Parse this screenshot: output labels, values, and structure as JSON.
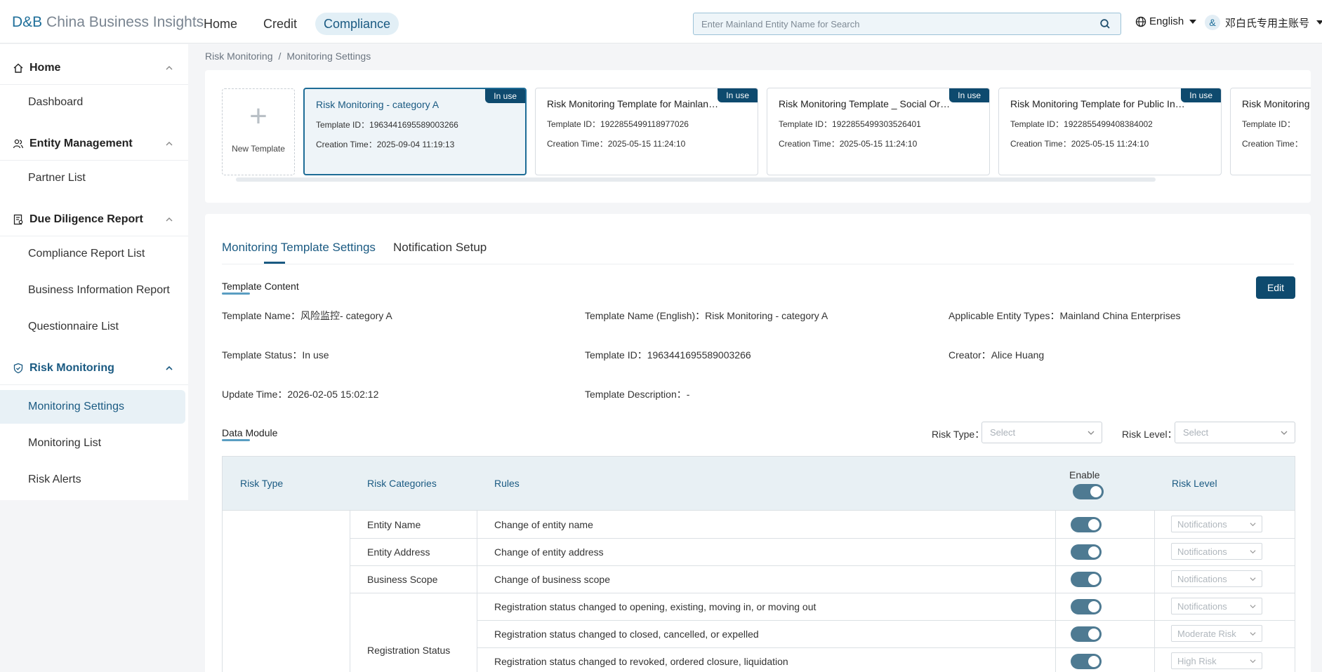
{
  "header": {
    "logo_db": "D&B",
    "logo_text": "China Business Insights",
    "nav": [
      "Home",
      "Credit",
      "Compliance"
    ],
    "search_placeholder": "Enter Mainland Entity Name for Search",
    "language": "English",
    "account": "邓白氏专用主账号"
  },
  "sidebar": {
    "sections": [
      {
        "label": "Home",
        "icon": "home-icon",
        "items": [
          "Dashboard"
        ]
      },
      {
        "label": "Entity Management",
        "icon": "users-icon",
        "items": [
          "Partner List"
        ]
      },
      {
        "label": "Due Diligence Report",
        "icon": "report-icon",
        "items": [
          "Compliance Report List",
          "Business Information Report",
          "Questionnaire List"
        ]
      },
      {
        "label": "Risk Monitoring",
        "icon": "shield-icon",
        "items": [
          "Monitoring Settings",
          "Monitoring List",
          "Risk Alerts"
        ]
      }
    ]
  },
  "breadcrumb": [
    "Risk Monitoring",
    "/",
    "Monitoring Settings"
  ],
  "templates": {
    "new_label": "New Template",
    "id_label": "Template ID：",
    "time_label": "Creation Time：",
    "cards": [
      {
        "name": "Risk Monitoring - category A",
        "id": "1963441695589003266",
        "time": "2025-09-04 11:19:13",
        "badge": "In use"
      },
      {
        "name": "Risk Monitoring Template for Mainland China Enterprises",
        "id": "1922855499118977026",
        "time": "2025-05-15 11:24:10",
        "badge": "In use"
      },
      {
        "name": "Risk Monitoring Template _ Social Organizations",
        "id": "1922855499303526401",
        "time": "2025-05-15 11:24:10",
        "badge": "In use"
      },
      {
        "name": "Risk Monitoring Template for Public Institutions",
        "id": "1922855499408384002",
        "time": "2025-05-15 11:24:10",
        "badge": "In use"
      },
      {
        "name": "Risk Monitoring",
        "id": "",
        "time": "",
        "badge": ""
      }
    ]
  },
  "tabs": [
    "Monitoring Template Settings",
    "Notification Setup"
  ],
  "template_content": {
    "title": "Template Content",
    "edit_label": "Edit",
    "fields": {
      "name": {
        "label": "Template Name：",
        "value": "风险监控- category A"
      },
      "name_en": {
        "label": "Template Name (English)：",
        "value": "Risk Monitoring - category A"
      },
      "entity_types": {
        "label": "Applicable Entity Types：",
        "value": "Mainland China Enterprises"
      },
      "status": {
        "label": "Template Status：",
        "value": "In use"
      },
      "id": {
        "label": "Template ID：",
        "value": "1963441695589003266"
      },
      "creator": {
        "label": "Creator：",
        "value": "Alice Huang"
      },
      "update_time": {
        "label": "Update Time：",
        "value": "2026-02-05 15:02:12"
      },
      "description": {
        "label": "Template Description：",
        "value": "-"
      }
    }
  },
  "data_module": {
    "title": "Data Module",
    "risk_type_label": "Risk Type：",
    "risk_level_label": "Risk Level：",
    "select_placeholder": "Select",
    "columns": [
      "Risk Type",
      "Risk Categories",
      "Rules",
      "Enable",
      "Risk Level"
    ],
    "rows": [
      {
        "category": "Entity Name",
        "rule": "Change of entity name",
        "level": "Notifications",
        "enabled": true
      },
      {
        "category": "Entity Address",
        "rule": "Change of entity address",
        "level": "Notifications",
        "enabled": true
      },
      {
        "category": "Business Scope",
        "rule": "Change of business scope",
        "level": "Notifications",
        "enabled": true
      },
      {
        "category": "Registration Status",
        "rule": "Registration status changed to opening, existing, moving in, or moving out",
        "level": "Notifications",
        "enabled": true
      },
      {
        "category": "",
        "rule": "Registration status changed to closed, cancelled, or expelled",
        "level": "Moderate Risk",
        "enabled": true
      },
      {
        "category": "",
        "rule": "Registration status changed to revoked, ordered closure, liquidation",
        "level": "High Risk",
        "enabled": true
      }
    ]
  },
  "colors": {
    "brand": "#0e4a6e",
    "accent": "#1a5a82",
    "toggle": "#4e7a92"
  }
}
